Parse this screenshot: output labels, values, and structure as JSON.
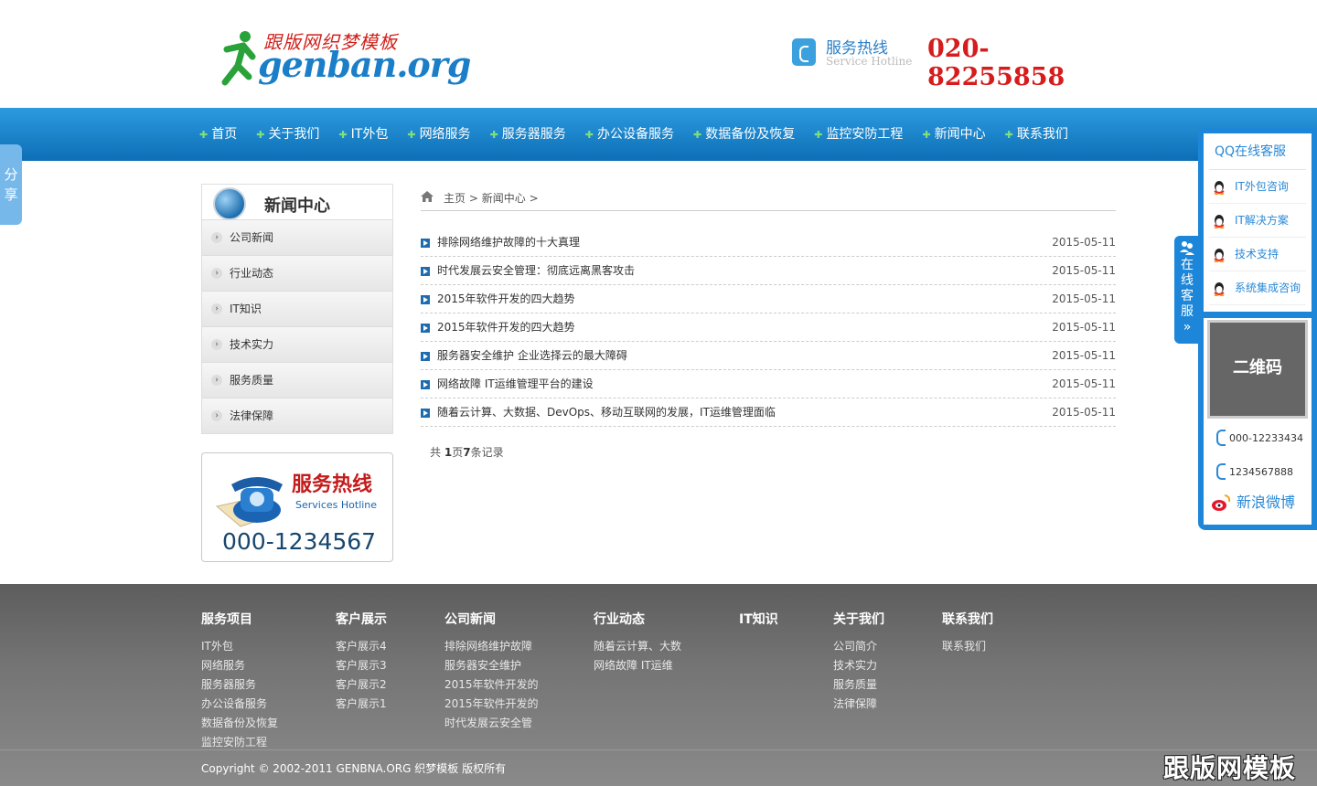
{
  "header": {
    "logo_sub": "跟版网织梦模板",
    "logo_main": "genban.org",
    "hotline_title": "服务热线",
    "hotline_en": "Service Hotline",
    "hotline_number": "020-82255858"
  },
  "nav": {
    "items": [
      "首页",
      "关于我们",
      "IT外包",
      "网络服务",
      "服务器服务",
      "办公设备服务",
      "数据备份及恢复",
      "监控安防工程",
      "新闻中心",
      "联系我们"
    ]
  },
  "share_tab": "分享",
  "sidebar": {
    "title": "新闻中心",
    "items": [
      "公司新闻",
      "行业动态",
      "IT知识",
      "技术实力",
      "服务质量",
      "法律保障"
    ],
    "hotline_title": "服务热线",
    "hotline_en": "Services Hotline",
    "hotline_number": "000-1234567"
  },
  "breadcrumb": {
    "home": "主页",
    "sep1": ">",
    "current": "新闻中心",
    "sep2": ">"
  },
  "news": [
    {
      "title": "排除网络维护故障的十大真理",
      "date": "2015-05-11"
    },
    {
      "title": "时代发展云安全管理：彻底远离黑客攻击",
      "date": "2015-05-11"
    },
    {
      "title": "2015年软件开发的四大趋势",
      "date": "2015-05-11"
    },
    {
      "title": "2015年软件开发的四大趋势",
      "date": "2015-05-11"
    },
    {
      "title": "服务器安全维护 企业选择云的最大障碍",
      "date": "2015-05-11"
    },
    {
      "title": "网络故障 IT运维管理平台的建设",
      "date": "2015-05-11"
    },
    {
      "title": "随着云计算、大数据、DevOps、移动互联网的发展，IT运维管理面临",
      "date": "2015-05-11"
    }
  ],
  "pager": {
    "prefix": "共 ",
    "pages": "1",
    "mid": "页",
    "records": "7",
    "suffix": "条记录"
  },
  "kefu": {
    "tab_text": [
      "在",
      "线",
      "客",
      "服"
    ],
    "tab_arrow": "»",
    "title": "QQ在线客服",
    "items": [
      "IT外包咨询",
      "IT解决方案",
      "技术支持",
      "系统集成咨询"
    ],
    "qr_label": "二维码",
    "phone1": "000-12233434",
    "phone2": "1234567888",
    "weibo": "新浪微博"
  },
  "footer": {
    "columns": [
      {
        "title": "服务项目",
        "links": [
          "IT外包",
          "网络服务",
          "服务器服务",
          "办公设备服务",
          "数据备份及恢复",
          "监控安防工程"
        ]
      },
      {
        "title": "客户展示",
        "links": [
          "客户展示4",
          "客户展示3",
          "客户展示2",
          "客户展示1"
        ]
      },
      {
        "title": "公司新闻",
        "links": [
          "排除网络维护故障",
          "服务器安全维护",
          "2015年软件开发的",
          "2015年软件开发的",
          "时代发展云安全管"
        ]
      },
      {
        "title": "行业动态",
        "links": [
          "随着云计算、大数",
          "网络故障 IT运维"
        ]
      },
      {
        "title": "IT知识",
        "links": []
      },
      {
        "title": "关于我们",
        "links": [
          "公司简介",
          "技术实力",
          "服务质量",
          "法律保障"
        ]
      },
      {
        "title": "联系我们",
        "links": [
          "联系我们"
        ]
      }
    ],
    "copyright": "Copyright © 2002-2011 GENBNA.ORG 织梦模板 版权所有",
    "watermark": "跟版网模板"
  },
  "colors": {
    "nav_top": "#2c9adf",
    "nav_bottom": "#0d6fb6",
    "hotline_red": "#d61c1c",
    "link_blue": "#2a88d6"
  }
}
